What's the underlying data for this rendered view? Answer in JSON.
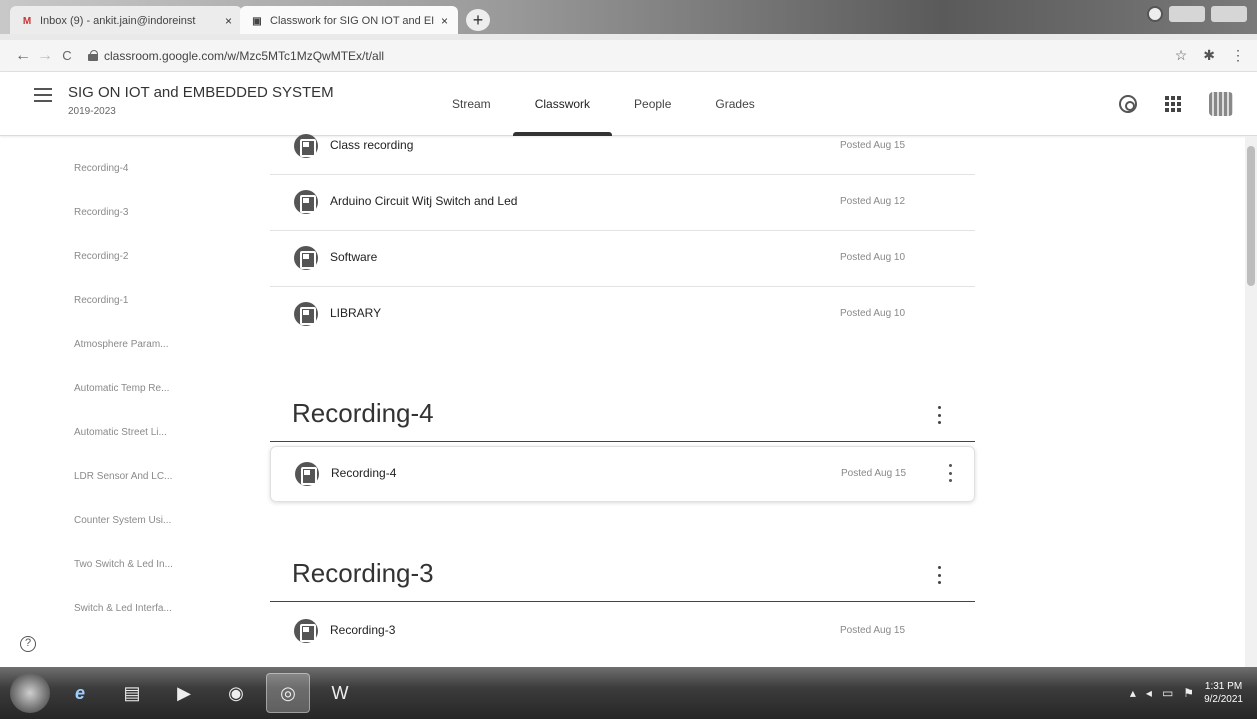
{
  "browser": {
    "tabs": [
      {
        "favicon": "M",
        "title": "Inbox (9) - ankit.jain@indoreinst",
        "close": "×"
      },
      {
        "favicon": "▣",
        "title": "Classwork for SIG ON IOT and EI",
        "close": "×"
      }
    ],
    "new_tab": "+",
    "url": "classroom.google.com/w/Mzc5MTc1MzQwMTEx/t/all",
    "nav": {
      "back": "←",
      "forward": "→",
      "reload": "C"
    },
    "right_icons": {
      "star": "☆",
      "extensions": "✱",
      "menu": "⋮"
    }
  },
  "classroom": {
    "course_title": "SIG ON IOT and EMBEDDED SYSTEM",
    "course_subtitle": "2019-2023",
    "tabs": [
      "Stream",
      "Classwork",
      "People",
      "Grades"
    ]
  },
  "sidebar": {
    "topics": [
      "Recording-4",
      "Recording-3",
      "Recording-2",
      "Recording-1",
      "Atmosphere Param...",
      "Automatic Temp Re...",
      "Automatic Street Li...",
      "LDR Sensor And LC...",
      "Counter System Usi...",
      "Two Switch & Led In...",
      "Switch & Led Interfa..."
    ],
    "help": "?"
  },
  "content": {
    "items_top": [
      {
        "title": "Class recording",
        "date": "Posted Aug 15"
      },
      {
        "title": "Arduino Circuit Witj Switch and Led",
        "date": "Posted Aug 12"
      },
      {
        "title": "Software",
        "date": "Posted Aug 10"
      },
      {
        "title": "LIBRARY",
        "date": "Posted Aug 10"
      }
    ],
    "sections": [
      {
        "title": "Recording-4",
        "items": [
          {
            "title": "Recording-4",
            "date": "Posted Aug 15"
          }
        ]
      },
      {
        "title": "Recording-3",
        "items": [
          {
            "title": "Recording-3",
            "date": "Posted Aug 15"
          }
        ]
      }
    ]
  },
  "taskbar": {
    "clock_time": "1:31 PM",
    "clock_date": "9/2/2021"
  }
}
